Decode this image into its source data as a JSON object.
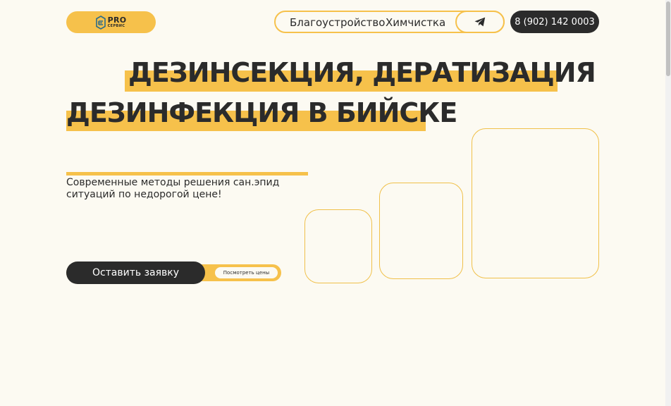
{
  "header": {
    "logo": {
      "primary": "PRO",
      "secondary": "СЕРВИС"
    },
    "nav": [
      {
        "label": "Благоустройство"
      },
      {
        "label": "Химчистка"
      }
    ],
    "telegram_icon": "telegram-plane-icon",
    "phone": "8 (902) 142 0003"
  },
  "hero": {
    "title_line1": "ДЕЗИНСЕКЦИЯ, ДЕРАТИЗАЦИЯ",
    "title_line2": "ДЕЗИНФЕКЦИЯ В БИЙСКЕ",
    "subtitle": "Современные методы решения сан.эпид ситуаций по недорогой цене!",
    "cta_primary": "Оставить заявку",
    "cta_secondary": "Посмотреть цены"
  },
  "colors": {
    "accent": "#f6c14b",
    "dark": "#2b2b2b",
    "background": "#fcfaf2"
  }
}
